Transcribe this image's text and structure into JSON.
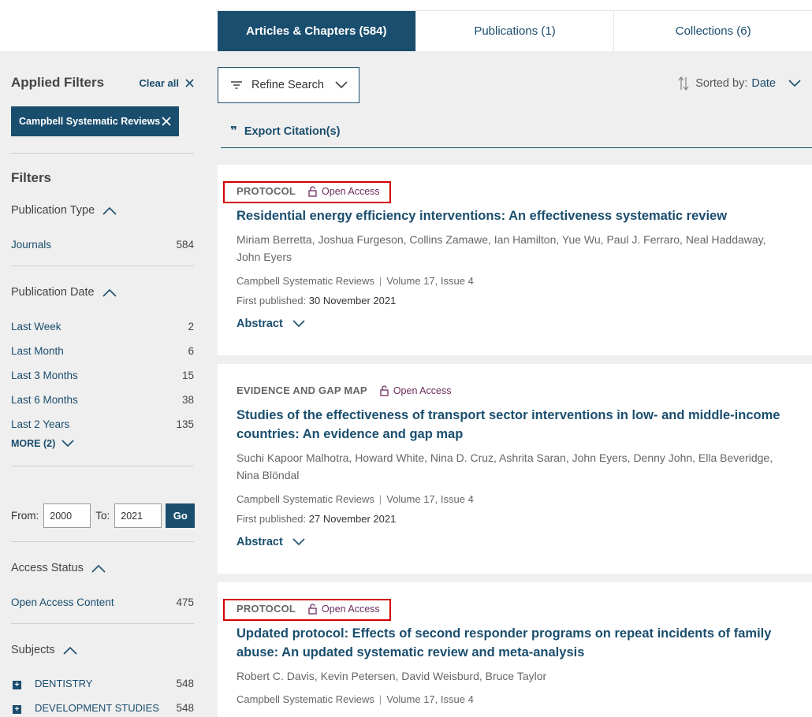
{
  "tabs": [
    {
      "label": "Articles & Chapters (584)",
      "active": true
    },
    {
      "label": "Publications (1)",
      "active": false
    },
    {
      "label": "Collections (6)",
      "active": false
    }
  ],
  "applied": {
    "title": "Applied Filters",
    "clear_all": "Clear all",
    "chip": "Campbell Systematic Reviews"
  },
  "filters": {
    "title": "Filters",
    "publication_type": {
      "title": "Publication Type",
      "items": [
        {
          "label": "Journals",
          "count": "584"
        }
      ]
    },
    "publication_date": {
      "title": "Publication Date",
      "items": [
        {
          "label": "Last Week",
          "count": "2"
        },
        {
          "label": "Last Month",
          "count": "6"
        },
        {
          "label": "Last 3 Months",
          "count": "15"
        },
        {
          "label": "Last 6 Months",
          "count": "38"
        },
        {
          "label": "Last 2 Years",
          "count": "135"
        }
      ],
      "more": "MORE (2)"
    },
    "range": {
      "from_label": "From:",
      "from_value": "2000",
      "to_label": "To:",
      "to_value": "2021",
      "go": "Go"
    },
    "access_status": {
      "title": "Access Status",
      "items": [
        {
          "label": "Open Access Content",
          "count": "475"
        }
      ]
    },
    "subjects": {
      "title": "Subjects",
      "items": [
        {
          "label": "DENTISTRY",
          "count": "548"
        },
        {
          "label": "DEVELOPMENT STUDIES",
          "count": "548"
        }
      ]
    }
  },
  "toolbar": {
    "refine": "Refine Search",
    "sorted_label": "Sorted by:",
    "sorted_value": "Date",
    "export": "Export Citation(s)"
  },
  "results": [
    {
      "type": "PROTOCOL",
      "oa": "Open Access",
      "title": "Residential energy efficiency interventions: An effectiveness systematic review",
      "authors": "Miriam Berretta, Joshua Furgeson, Collins Zamawe, Ian Hamilton, Yue Wu, Paul J. Ferraro, Neal Haddaway, John Eyers",
      "journal": "Campbell Systematic Reviews",
      "volume": "Volume 17, Issue 4",
      "published_label": "First published:",
      "published_date": "30 November 2021",
      "abstract": "Abstract"
    },
    {
      "type": "EVIDENCE AND GAP MAP",
      "oa": "Open Access",
      "title": "Studies of the effectiveness of transport sector interventions in low- and middle-income countries: An evidence and gap map",
      "authors": "Suchi Kapoor Malhotra, Howard White, Nina D. Cruz, Ashrita Saran, John Eyers, Denny John, Ella Beveridge, Nina Blöndal",
      "journal": "Campbell Systematic Reviews",
      "volume": "Volume 17, Issue 4",
      "published_label": "First published:",
      "published_date": "27 November 2021",
      "abstract": "Abstract"
    },
    {
      "type": "PROTOCOL",
      "oa": "Open Access",
      "title": "Updated protocol: Effects of second responder programs on repeat incidents of family abuse: An updated systematic review and meta-analysis",
      "authors": "Robert C. Davis, Kevin Petersen, David Weisburd, Bruce Taylor",
      "journal": "Campbell Systematic Reviews",
      "volume": "Volume 17, Issue 4"
    }
  ],
  "colors": {
    "brand": "#1a4e6e",
    "open_access": "#6c2c5e",
    "highlight": "#d40000"
  }
}
